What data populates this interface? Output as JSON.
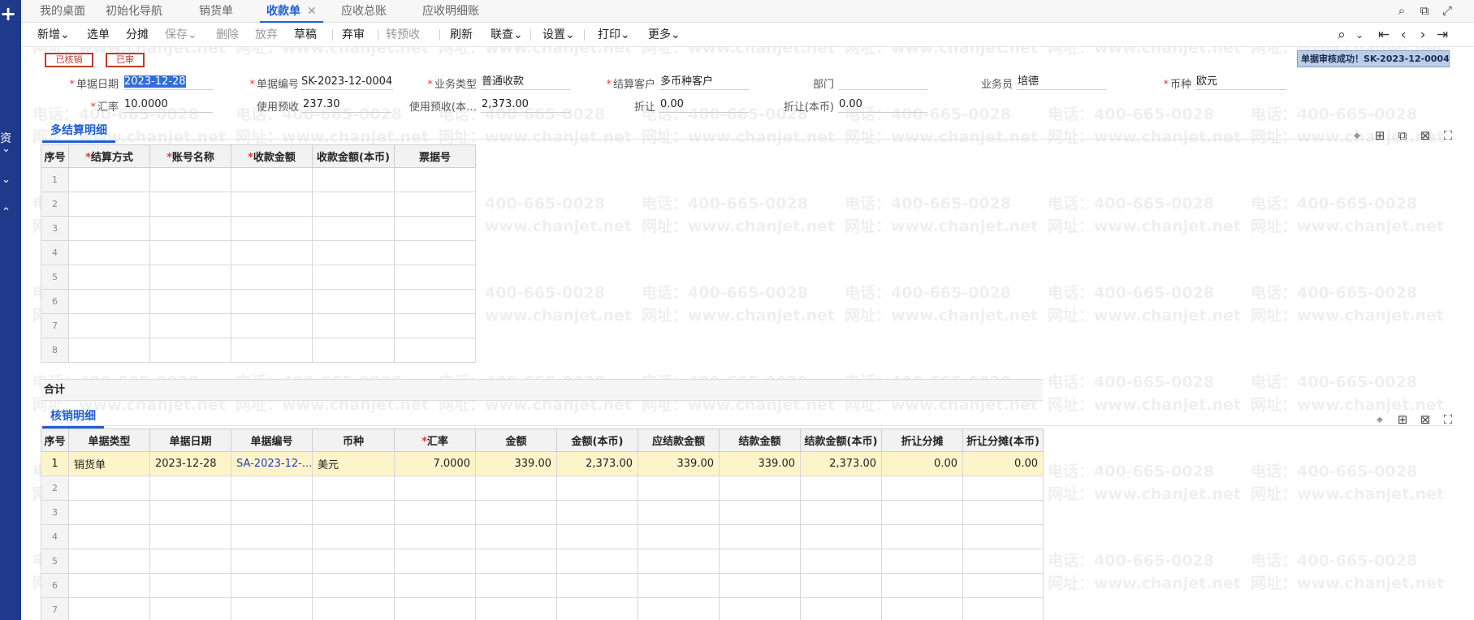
{
  "tabs": [
    {
      "label": "我的桌面"
    },
    {
      "label": "初始化导航"
    },
    {
      "label": "销货单"
    },
    {
      "label": "收款单",
      "active": true,
      "close": "✕"
    },
    {
      "label": "应收总账"
    },
    {
      "label": "应收明细账"
    }
  ],
  "sidebar": {
    "plus": "+",
    "label": "资"
  },
  "toolbar": {
    "new": "新增",
    "select": "选单",
    "split": "分摊",
    "save": "保存",
    "delete": "删除",
    "abandon": "放弃",
    "draft": "草稿",
    "unaudit": "弃审",
    "transfer_prepay": "转预收",
    "refresh": "刷新",
    "lookup": "联查",
    "settings": "设置",
    "print": "打印",
    "more": "更多"
  },
  "toast": "单据审核成功！SK-2023-12-0004",
  "stamps": {
    "verified": "已核销",
    "audited": "已审"
  },
  "form": {
    "date_label": "单据日期",
    "date_value": "2023-12-28",
    "no_label": "单据编号",
    "no_value": "SK-2023-12-0004",
    "biz_type_label": "业务类型",
    "biz_type_value": "普通收款",
    "customer_label": "结算客户",
    "customer_value": "多币种客户",
    "dept_label": "部门",
    "dept_value": "",
    "clerk_label": "业务员",
    "clerk_value": "培德",
    "currency_label": "币种",
    "currency_value": "欧元",
    "rate_label": "汇率",
    "rate_value": "10.0000",
    "prepay_label": "使用预收",
    "prepay_value": "237.30",
    "prepay_local_label": "使用预收(本…",
    "prepay_local_value": "2,373.00",
    "discount_label": "折让",
    "discount_value": "0.00",
    "discount_local_label": "折让(本币)",
    "discount_local_value": "0.00"
  },
  "settlement": {
    "title": "多结算明细",
    "columns": [
      "序号",
      "结算方式",
      "账号名称",
      "收款金额",
      "收款金额(本币)",
      "票据号"
    ],
    "rows": [
      "1",
      "2",
      "3",
      "4",
      "5",
      "6",
      "7",
      "8"
    ],
    "total_label": "合计"
  },
  "writeoff": {
    "title": "核销明细",
    "columns": [
      "序号",
      "单据类型",
      "单据日期",
      "单据编号",
      "币种",
      "汇率",
      "金额",
      "金额(本币)",
      "应结款金额",
      "结款金额",
      "结款金额(本币)",
      "折让分摊",
      "折让分摊(本币)"
    ],
    "row1": {
      "idx": "1",
      "type": "销货单",
      "date": "2023-12-28",
      "no": "SA-2023-12-...",
      "currency": "美元",
      "rate": "7.0000",
      "amount": "339.00",
      "amount_local": "2,373.00",
      "due": "339.00",
      "settled": "339.00",
      "settled_local": "2,373.00",
      "disc": "0.00",
      "disc_local": "0.00"
    },
    "rows": [
      "2",
      "3",
      "4",
      "5",
      "6",
      "7"
    ]
  },
  "watermark": {
    "phone": "电话：400-665-0028",
    "site": "网址：www.chanjet.net"
  }
}
